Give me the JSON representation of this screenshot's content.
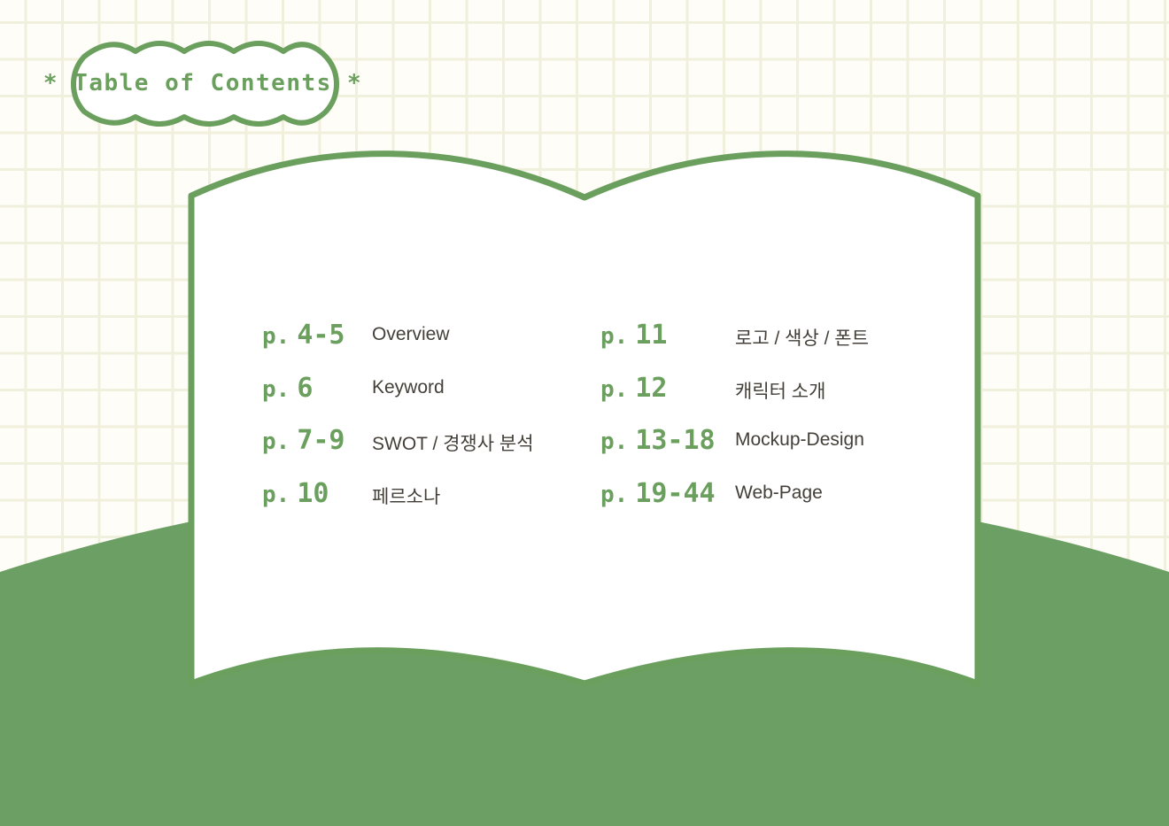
{
  "title": "* Table of Contents *",
  "page_prefix": "p.",
  "colors": {
    "accent_green": "#6a9f5d",
    "grid_background": "#fefdf8",
    "grid_line": "#f1f0dd",
    "text": "#444039",
    "book_page": "#ffffff"
  },
  "toc": {
    "left": [
      {
        "pages": "4-5",
        "topic": "Overview"
      },
      {
        "pages": "6",
        "topic": "Keyword"
      },
      {
        "pages": "7-9",
        "topic": "SWOT / 경쟁사 분석"
      },
      {
        "pages": "10",
        "topic": "페르소나"
      }
    ],
    "right": [
      {
        "pages": "11",
        "topic": "로고 /  색상 / 폰트"
      },
      {
        "pages": "12",
        "topic": "캐릭터 소개"
      },
      {
        "pages": "13-18",
        "topic": "Mockup-Design"
      },
      {
        "pages": "19-44",
        "topic": "Web-Page"
      }
    ]
  }
}
